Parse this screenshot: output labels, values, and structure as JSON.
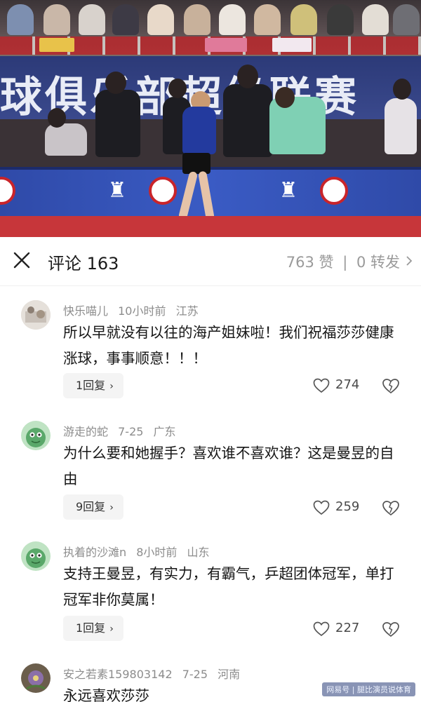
{
  "video": {
    "banner_text": "球俱乐部超级联赛"
  },
  "header": {
    "title": "评论 163",
    "likes": "763 赞",
    "separator": "|",
    "shares": "0 转发"
  },
  "comments": [
    {
      "user": "快乐喵儿",
      "time": "10小时前",
      "location": "江苏",
      "text": "所以早就没有以往的海产姐妹啦！我们祝福莎莎健康涨球，事事顺意！！！",
      "reply_label": "1回复",
      "likes": "274",
      "avatar_color": "#d9d2cc"
    },
    {
      "user": "游走的蛇",
      "time": "7-25",
      "location": "广东",
      "text": "为什么要和她握手？喜欢谁不喜欢谁？这是曼昱的自由",
      "reply_label": "9回复",
      "likes": "259",
      "avatar_color": "#6fb37a"
    },
    {
      "user": "执着的沙滩n",
      "time": "8小时前",
      "location": "山东",
      "text": "支持王曼昱，有实力，有霸气，乒超团体冠军，单打冠军非你莫属！",
      "reply_label": "1回复",
      "likes": "227",
      "avatar_color": "#6fb37a"
    },
    {
      "user": "安之若素159803142",
      "time": "7-25",
      "location": "河南",
      "text": "永远喜欢莎莎",
      "reply_label": "",
      "likes": "",
      "avatar_color": "#7a6a58"
    }
  ],
  "watermark": "网易号 | 腿比演员说体育",
  "colors": {
    "accent_text": "#161616",
    "meta_text": "#8c8c8c",
    "reply_bg": "#f4f4f4",
    "adboard_blue": "#3a5bc4",
    "floor_red": "#c7363a"
  },
  "icons": [
    "close-icon",
    "chevron-right-icon",
    "heart-icon",
    "broken-heart-icon",
    "chevron-right-small-icon"
  ]
}
